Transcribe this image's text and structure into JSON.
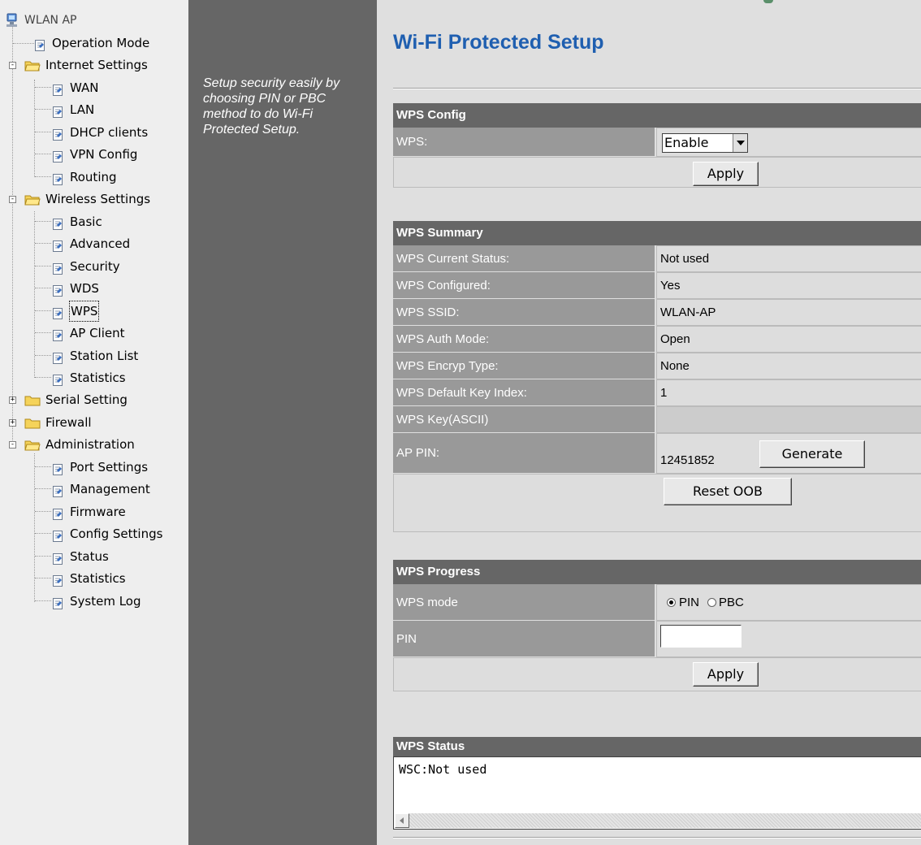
{
  "tree": {
    "root": "WLAN AP",
    "items": [
      {
        "label": "Operation Mode"
      },
      {
        "label": "Internet Settings"
      },
      {
        "label": "WAN"
      },
      {
        "label": "LAN"
      },
      {
        "label": "DHCP clients"
      },
      {
        "label": "VPN Config"
      },
      {
        "label": "Routing"
      },
      {
        "label": "Wireless Settings"
      },
      {
        "label": "Basic"
      },
      {
        "label": "Advanced"
      },
      {
        "label": "Security"
      },
      {
        "label": "WDS"
      },
      {
        "label": "WPS"
      },
      {
        "label": "AP Client"
      },
      {
        "label": "Station List"
      },
      {
        "label": "Statistics"
      },
      {
        "label": "Serial Setting"
      },
      {
        "label": "Firewall"
      },
      {
        "label": "Administration"
      },
      {
        "label": "Port Settings"
      },
      {
        "label": "Management"
      },
      {
        "label": "Firmware"
      },
      {
        "label": "Config Settings"
      },
      {
        "label": "Status"
      },
      {
        "label": "Statistics"
      },
      {
        "label": "System Log"
      }
    ]
  },
  "description": "Setup security easily by choosing PIN or PBC method to do Wi-Fi Protected Setup.",
  "main": {
    "title": "Wi-Fi Protected Setup",
    "config": {
      "header": "WPS Config",
      "wps_label": "WPS:",
      "wps_value": "Enable",
      "apply": "Apply"
    },
    "summary": {
      "header": "WPS Summary",
      "rows": [
        {
          "label": "WPS Current Status:",
          "value": "Not used"
        },
        {
          "label": "WPS Configured:",
          "value": "Yes"
        },
        {
          "label": "WPS SSID:",
          "value": "WLAN-AP"
        },
        {
          "label": "WPS Auth Mode:",
          "value": "Open"
        },
        {
          "label": "WPS Encryp Type:",
          "value": "None"
        },
        {
          "label": "WPS Default Key Index:",
          "value": "1"
        },
        {
          "label": "WPS Key(ASCII)",
          "value": ""
        }
      ],
      "ap_pin_label": "AP PIN:",
      "ap_pin_value": "12451852",
      "generate": "Generate",
      "reset": "Reset OOB"
    },
    "progress": {
      "header": "WPS Progress",
      "mode_label": "WPS mode",
      "opt_pin": "PIN",
      "opt_pbc": "PBC",
      "selected": "PIN",
      "pin_label": "PIN",
      "pin_value": "",
      "apply": "Apply"
    },
    "status": {
      "header": "WPS Status",
      "text": "WSC:Not used"
    }
  },
  "colors": {
    "title": "#1f5fb0",
    "header_bg": "#666666",
    "label_bg": "#999999",
    "value_bg": "#dddddd",
    "page_bg": "#dfdfdf",
    "tree_bg": "#eeeeee"
  }
}
